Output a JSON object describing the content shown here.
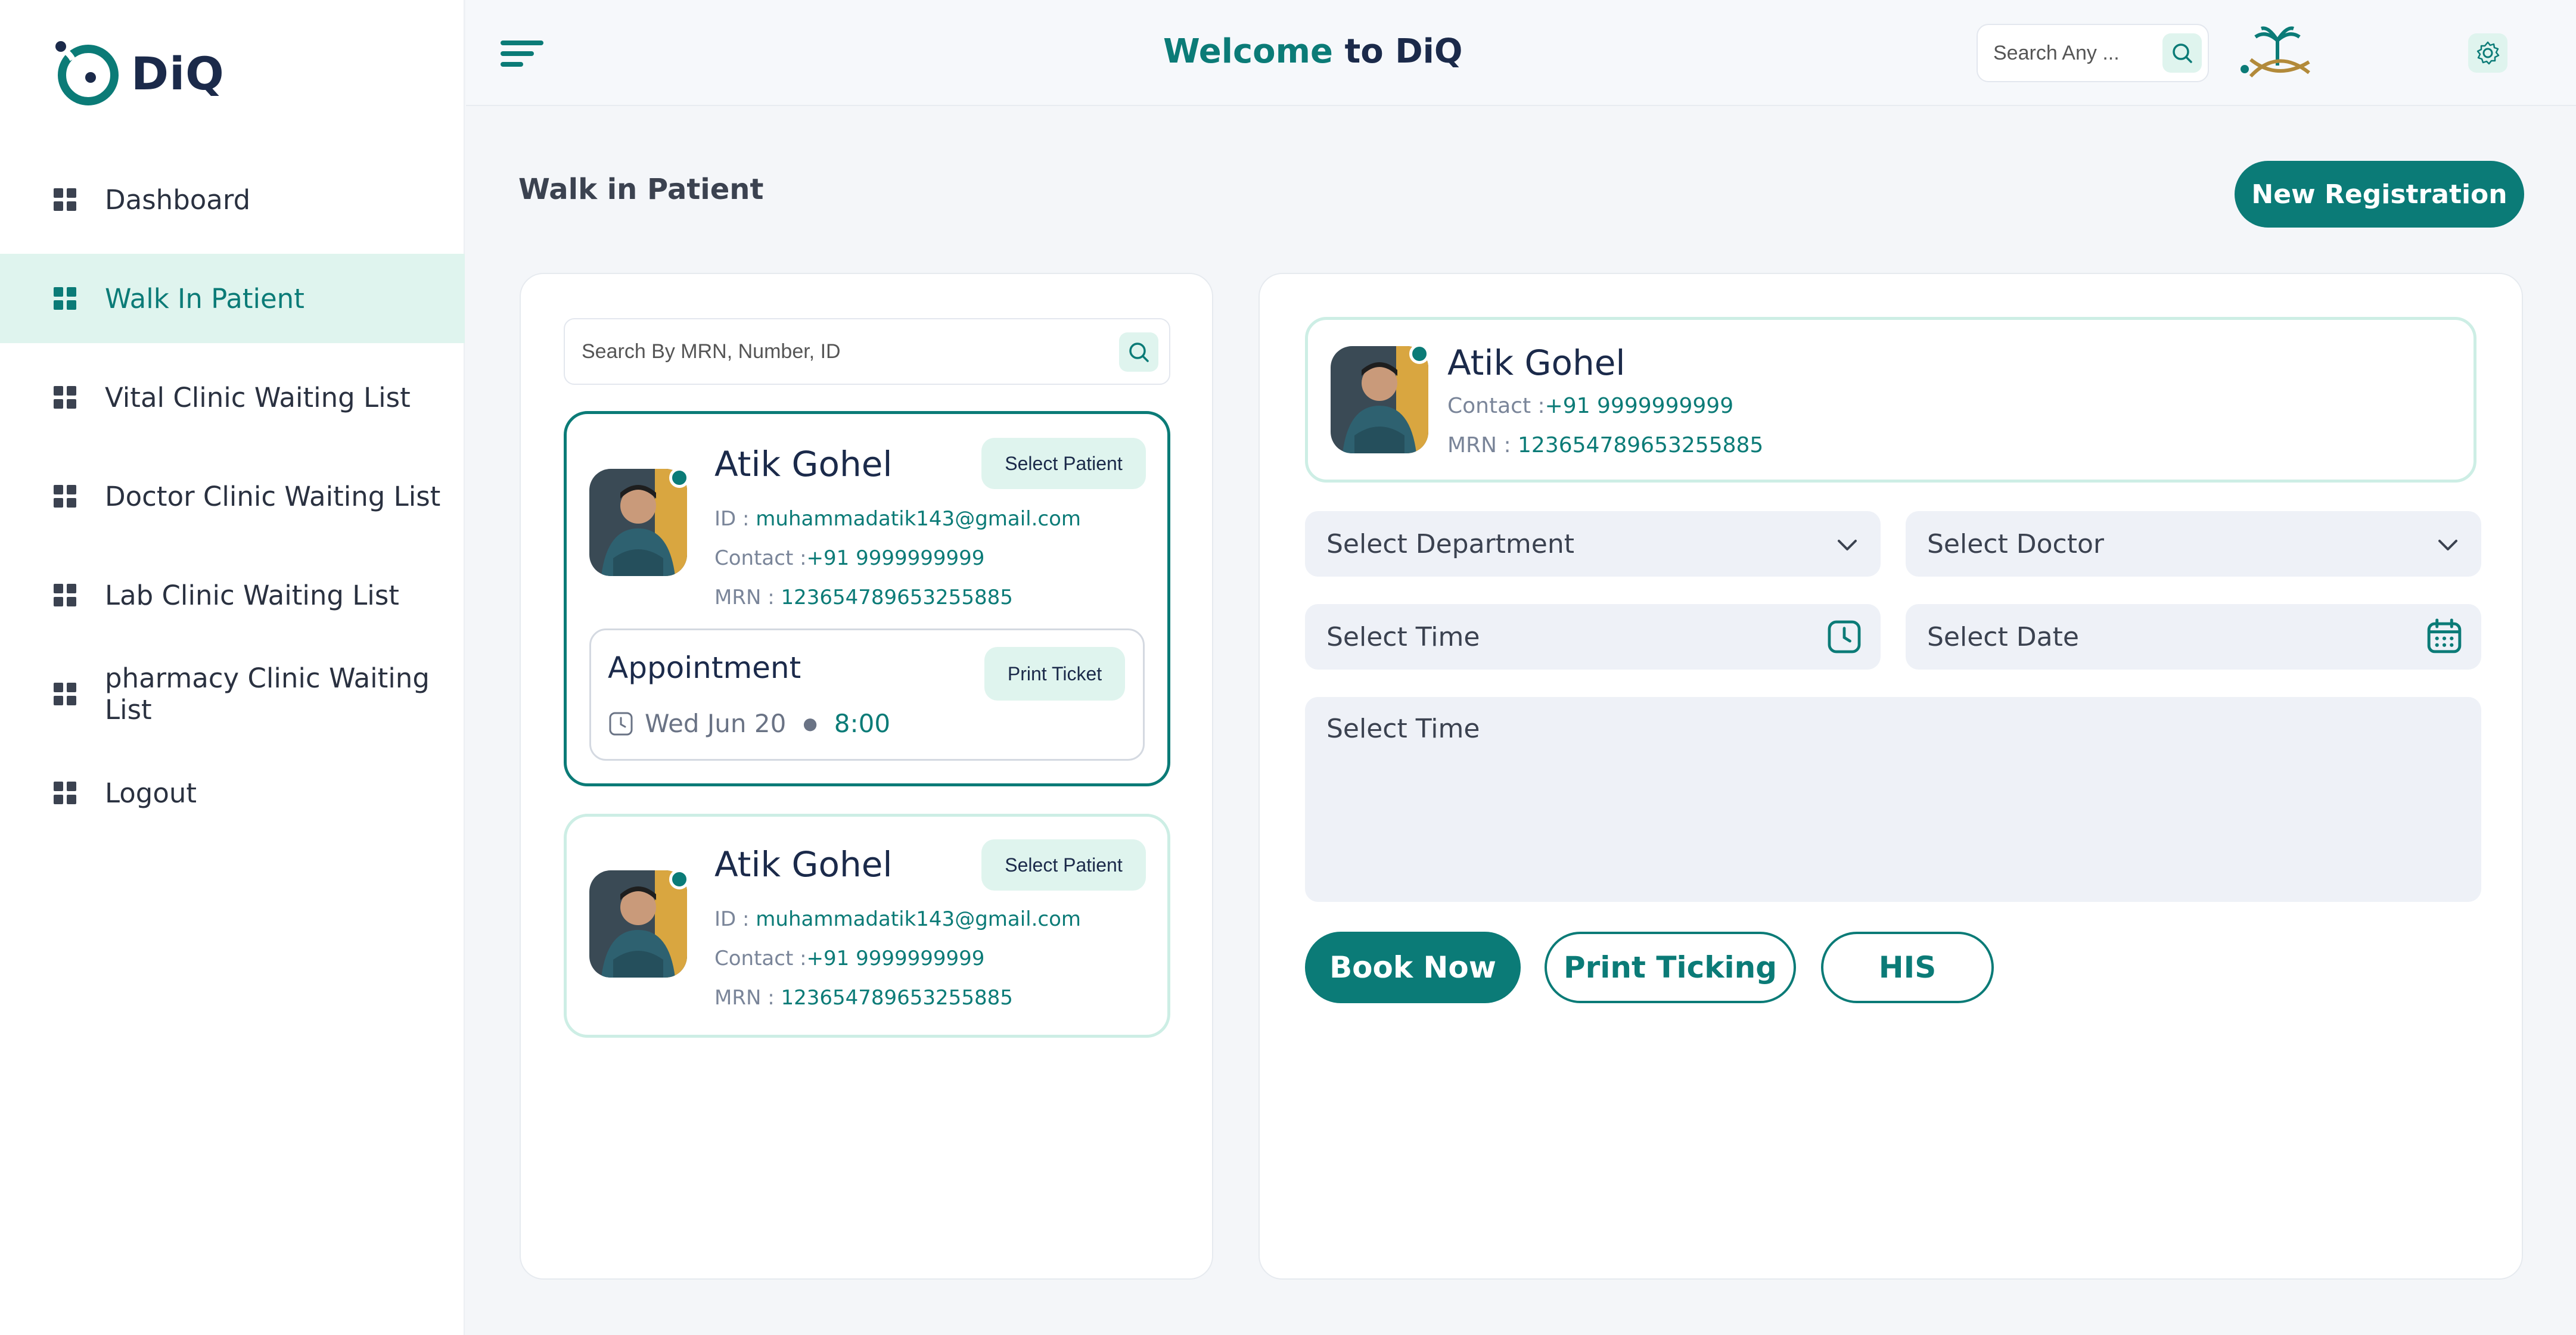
{
  "app": {
    "logo_text": "DiQ"
  },
  "header": {
    "welcome_prefix": "Welcome",
    "welcome_suffix": "to DiQ",
    "search_placeholder": "Search Any ..."
  },
  "sidebar": {
    "items": [
      {
        "label": "Dashboard",
        "active": false
      },
      {
        "label": "Walk In Patient",
        "active": true
      },
      {
        "label": "Vital Clinic Waiting List",
        "active": false
      },
      {
        "label": "Doctor Clinic Waiting List",
        "active": false
      },
      {
        "label": "Lab Clinic Waiting List",
        "active": false
      },
      {
        "label": "pharmacy Clinic Waiting List",
        "active": false
      },
      {
        "label": "Logout",
        "active": false
      }
    ]
  },
  "page": {
    "title": "Walk in Patient",
    "new_registration_label": "New Registration"
  },
  "patient_list": {
    "search_placeholder": "Search By MRN, Number, ID",
    "cards": [
      {
        "name": "Atik Gohel",
        "id_label": "ID : ",
        "id_value": "muhammadatik143@gmail.com",
        "contact_label": "Contact :",
        "contact_value": "+91 9999999999",
        "mrn_label": "MRN : ",
        "mrn_value": "123654789653255885",
        "select_label": "Select Patient",
        "appointment": {
          "title": "Appointment",
          "print_label": "Print Ticket",
          "date": "Wed Jun 20",
          "time": "8:00"
        }
      },
      {
        "name": "Atik Gohel",
        "id_label": "ID : ",
        "id_value": "muhammadatik143@gmail.com",
        "contact_label": "Contact :",
        "contact_value": "+91 9999999999",
        "mrn_label": "MRN : ",
        "mrn_value": "123654789653255885",
        "select_label": "Select Patient"
      }
    ]
  },
  "booking": {
    "patient": {
      "name": "Atik Gohel",
      "contact_label": "Contact :",
      "contact_value": "+91 9999999999",
      "mrn_label": "MRN : ",
      "mrn_value": "123654789653255885"
    },
    "department_placeholder": "Select Department",
    "doctor_placeholder": "Select Doctor",
    "time_placeholder": "Select Time",
    "date_placeholder": "Select Date",
    "notes_placeholder": "Select Time",
    "book_label": "Book Now",
    "print_label": "Print Ticking",
    "his_label": "HIS"
  },
  "colors": {
    "accent": "#0b7b77",
    "accent_light": "#dff4ee",
    "field_bg": "#eef1f7"
  }
}
